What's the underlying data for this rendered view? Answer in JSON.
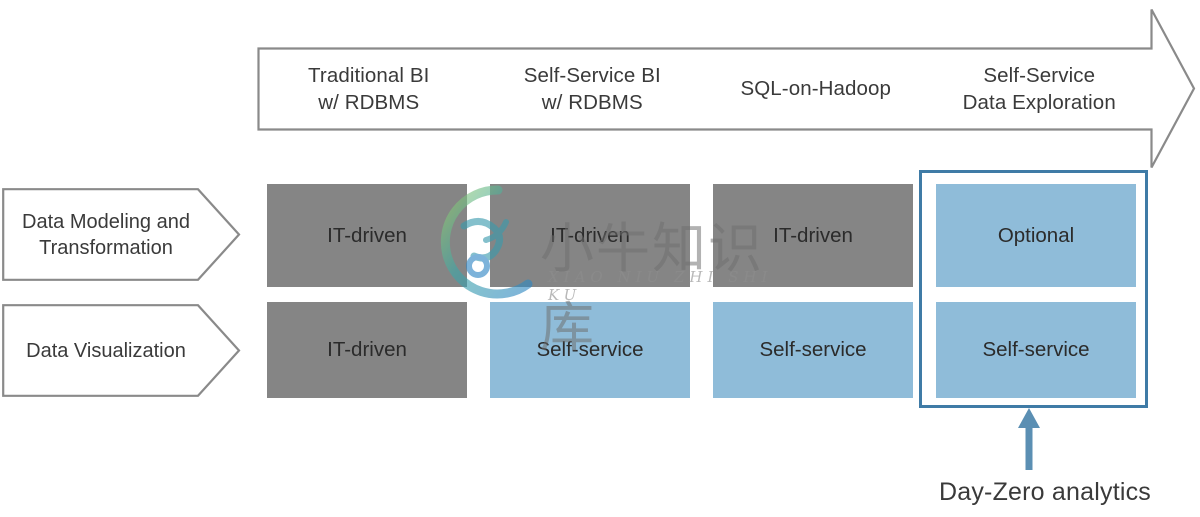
{
  "diagram": {
    "title_caption": "Day-Zero analytics",
    "colors": {
      "gray_cell": "#858585",
      "blue_cell": "#8fbcd9",
      "highlight_border": "#3f7ba6",
      "outline_gray": "#8a8a8a",
      "text": "#3a3a3a"
    },
    "banner": {
      "stages": [
        {
          "label": "Traditional BI\nw/ RDBMS"
        },
        {
          "label": "Self-Service BI\nw/ RDBMS"
        },
        {
          "label": "SQL-on-Hadoop"
        },
        {
          "label": "Self-Service\nData Exploration"
        }
      ]
    },
    "rows": [
      {
        "label": "Data Modeling and\nTransformation"
      },
      {
        "label": "Data Visualization"
      }
    ],
    "matrix": [
      [
        {
          "text": "IT-driven",
          "style": "gray"
        },
        {
          "text": "IT-driven",
          "style": "gray"
        },
        {
          "text": "IT-driven",
          "style": "gray"
        },
        {
          "text": "Optional",
          "style": "blue"
        }
      ],
      [
        {
          "text": "IT-driven",
          "style": "gray"
        },
        {
          "text": "Self-service",
          "style": "blue"
        },
        {
          "text": "Self-service",
          "style": "blue"
        },
        {
          "text": "Self-service",
          "style": "blue"
        }
      ]
    ],
    "highlight": {
      "column_index": 3
    },
    "watermark": {
      "chinese": "小牛知识库",
      "pinyin": "XIAO NIU ZHI SHI KU"
    }
  }
}
